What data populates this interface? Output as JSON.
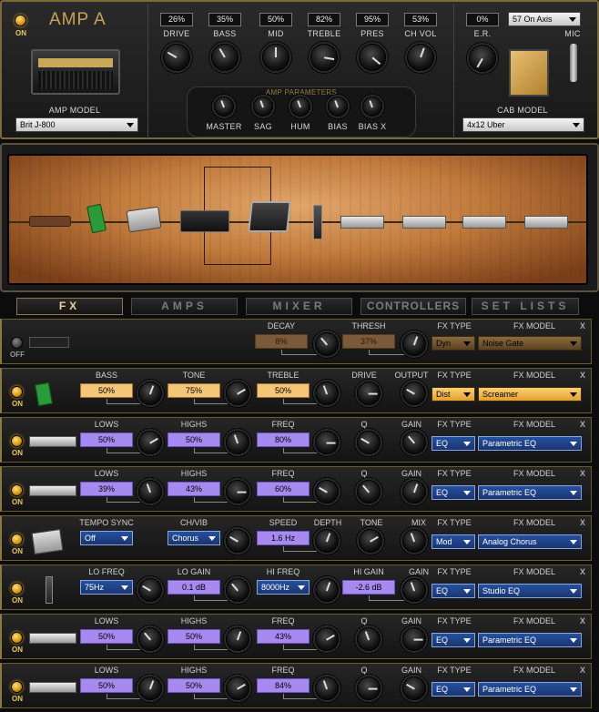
{
  "amp": {
    "on_label": "ON",
    "title": "AMP A",
    "amp_model_label": "AMP MODEL",
    "amp_model_value": "Brit J-800",
    "knobs": [
      {
        "label": "DRIVE",
        "value": "26%"
      },
      {
        "label": "BASS",
        "value": "35%"
      },
      {
        "label": "MID",
        "value": "50%"
      },
      {
        "label": "TREBLE",
        "value": "82%"
      },
      {
        "label": "PRES",
        "value": "95%"
      },
      {
        "label": "CH VOL",
        "value": "53%"
      }
    ],
    "params_title": "AMP PARAMETERS",
    "params": [
      "MASTER",
      "SAG",
      "HUM",
      "BIAS",
      "BIAS X"
    ],
    "er_label": "E.R.",
    "er_value": "0%",
    "mic_label": "MIC",
    "mic_value": "57 On Axis",
    "cab_model_label": "CAB MODEL",
    "cab_model_value": "4x12 Uber"
  },
  "tabs": [
    "FX",
    "AMPS",
    "MIXER",
    "CONTROLLERS",
    "SET LISTS"
  ],
  "fx_rows": [
    {
      "on": "OFF",
      "params": [
        {
          "h": "DECAY",
          "v": "8%"
        },
        {
          "h": "THRESH",
          "v": "37%"
        }
      ],
      "fx_type_label": "FX TYPE",
      "fx_type": "Dyn",
      "fx_model_label": "FX MODEL",
      "fx_model": "Noise Gate",
      "close": "X"
    },
    {
      "on": "ON",
      "params": [
        {
          "h": "BASS",
          "v": "50%"
        },
        {
          "h": "TONE",
          "v": "75%"
        },
        {
          "h": "TREBLE",
          "v": "50%"
        },
        {
          "h": "DRIVE"
        },
        {
          "h": "OUTPUT"
        }
      ],
      "fx_type_label": "FX TYPE",
      "fx_type": "Dist",
      "fx_model_label": "FX MODEL",
      "fx_model": "Screamer",
      "close": "X"
    },
    {
      "on": "ON",
      "params": [
        {
          "h": "LOWS",
          "v": "50%"
        },
        {
          "h": "HIGHS",
          "v": "50%"
        },
        {
          "h": "FREQ",
          "v": "80%"
        },
        {
          "h": "Q"
        },
        {
          "h": "GAIN"
        }
      ],
      "fx_type_label": "FX TYPE",
      "fx_type": "EQ",
      "fx_model_label": "FX MODEL",
      "fx_model": "Parametric EQ",
      "close": "X"
    },
    {
      "on": "ON",
      "params": [
        {
          "h": "LOWS",
          "v": "39%"
        },
        {
          "h": "HIGHS",
          "v": "43%"
        },
        {
          "h": "FREQ",
          "v": "60%"
        },
        {
          "h": "Q"
        },
        {
          "h": "GAIN"
        }
      ],
      "fx_type_label": "FX TYPE",
      "fx_type": "EQ",
      "fx_model_label": "FX MODEL",
      "fx_model": "Parametric EQ",
      "close": "X"
    },
    {
      "on": "ON",
      "params": [
        {
          "h": "TEMPO SYNC",
          "v": "Off"
        },
        {
          "h": "CH/VIB",
          "v": "Chorus"
        },
        {
          "h": "SPEED",
          "v": "1.6 Hz"
        },
        {
          "h": "DEPTH"
        },
        {
          "h": "TONE"
        },
        {
          "h": "MIX"
        }
      ],
      "fx_type_label": "FX TYPE",
      "fx_type": "Mod",
      "fx_model_label": "FX MODEL",
      "fx_model": "Analog Chorus",
      "close": "X"
    },
    {
      "on": "ON",
      "params": [
        {
          "h": "LO FREQ",
          "v": "75Hz"
        },
        {
          "h": "LO GAIN",
          "v": "0.1 dB"
        },
        {
          "h": "HI FREQ",
          "v": "8000Hz"
        },
        {
          "h": "HI GAIN",
          "v": "-2.6 dB"
        },
        {
          "h": "GAIN"
        }
      ],
      "fx_type_label": "FX TYPE",
      "fx_type": "EQ",
      "fx_model_label": "FX MODEL",
      "fx_model": "Studio EQ",
      "close": "X"
    },
    {
      "on": "ON",
      "params": [
        {
          "h": "LOWS",
          "v": "50%"
        },
        {
          "h": "HIGHS",
          "v": "50%"
        },
        {
          "h": "FREQ",
          "v": "43%"
        },
        {
          "h": "Q"
        },
        {
          "h": "GAIN"
        }
      ],
      "fx_type_label": "FX TYPE",
      "fx_type": "EQ",
      "fx_model_label": "FX MODEL",
      "fx_model": "Parametric EQ",
      "close": "X"
    },
    {
      "on": "ON",
      "params": [
        {
          "h": "LOWS",
          "v": "50%"
        },
        {
          "h": "HIGHS",
          "v": "50%"
        },
        {
          "h": "FREQ",
          "v": "84%"
        },
        {
          "h": "Q"
        },
        {
          "h": "GAIN"
        }
      ],
      "fx_type_label": "FX TYPE",
      "fx_type": "EQ",
      "fx_model_label": "FX MODEL",
      "fx_model": "Parametric EQ",
      "close": "X"
    }
  ]
}
